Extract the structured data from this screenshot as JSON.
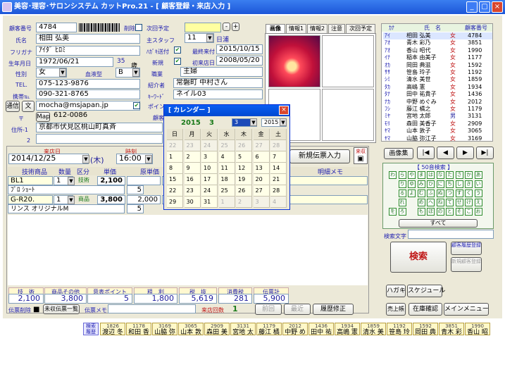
{
  "window": {
    "title": "美容･理容･サロンシステム カットPro.21 - [ 顧客登録・来店入力 ]",
    "min": "_",
    "max": "▢",
    "close": "×"
  },
  "customer": {
    "no_label": "顧客番号",
    "no": "4784",
    "delete_label": "削除",
    "name_label": "氏名",
    "name": "相田 弘美",
    "kana_label": "フリガナ",
    "kana": "ｱｲﾀﾞ ﾋﾛﾐ",
    "birth_label": "生年月日",
    "birth": "1972/06/21",
    "age": "35",
    "age_unit": "歳",
    "sex_label": "性別",
    "sex": "女",
    "blood_label": "血液型",
    "blood": "B",
    "tel_label": "TEL.",
    "tel": "075-123-9876",
    "mobile_label": "携帯℡",
    "mobile": "090-321-8765",
    "comm_btn": "通信",
    "text_btn": "文",
    "email": "mocha@msjapan.jp",
    "zip_label": "〒",
    "map_btn": "Map",
    "zip": "612-0086",
    "addr1_label": "住所-1",
    "addr1": "京都市伏見区桃山町真斉",
    "addr2_label": "2",
    "addr2": "",
    "next_label": "次回予定",
    "next_plus": "+",
    "next_minus": "-",
    "staff_label": "主スタッフ",
    "staff": "11",
    "staff_kind": "日浦",
    "dm_label": "ﾊｶﾞｷ送付",
    "last_label": "最終来付",
    "last_date": "2015/10/15",
    "new_label": "新規",
    "first_label": "初来店日",
    "first_date": "2008/05/20",
    "job_label": "職業",
    "job": "主婦",
    "intro_label": "紹介者",
    "intro": "常磐町 中村さん",
    "keyword_label": "ｷｰﾜｰﾄﾞ",
    "keyword": "ネイル03",
    "point_label": "ポイン",
    "note_label": "顧客"
  },
  "tabs": [
    "画像",
    "情報1",
    "情報2",
    "注意",
    "次回予定"
  ],
  "custlist": {
    "h1": "ｶﾅ",
    "h2": "氏　名",
    "h3": "顧客番号",
    "rows": [
      [
        "ｱｲ",
        "相田 弘美",
        "女",
        "4784"
      ],
      [
        "ｱｵ",
        "青木 彩乃",
        "女",
        "3851"
      ],
      [
        "ｱｵ",
        "香山 昭代",
        "女",
        "1990"
      ],
      [
        "ｲﾅ",
        "稲本 由美子",
        "女",
        "1177"
      ],
      [
        "ｵｶ",
        "岡田 典滋",
        "女",
        "1592"
      ],
      [
        "ｻｻ",
        "笹島 玲子",
        "女",
        "1192"
      ],
      [
        "ｼﾐ",
        "清水 美世",
        "女",
        "1859"
      ],
      [
        "ﾀｶ",
        "高嶋 憲",
        "女",
        "1934"
      ],
      [
        "ﾀﾅ",
        "田中 祐貴子",
        "女",
        "1436"
      ],
      [
        "ﾅｶ",
        "中野 めぐみ",
        "女",
        "2012"
      ],
      [
        "ﾌｼ",
        "藤江 橘之",
        "女",
        "1179"
      ],
      [
        "ﾐﾔ",
        "宮地 太郎",
        "男",
        "3131"
      ],
      [
        "ﾓﾘ",
        "森田 美香子",
        "女",
        "2909"
      ],
      [
        "ﾔﾏ",
        "山本 敦子",
        "女",
        "3065"
      ],
      [
        "ﾔﾏ",
        "山脇 弥江子",
        "女",
        "3169"
      ]
    ]
  },
  "image_label": "画像集",
  "nav": [
    "|◀",
    "◀",
    "▶",
    "▶|"
  ],
  "kana_title": "【 50音検索 】",
  "kana_rows": [
    [
      "わ",
      "ら",
      "や",
      "ま",
      "は",
      "な",
      "た",
      "さ",
      "か",
      "あ"
    ],
    [
      "",
      "り",
      "ゆ",
      "み",
      "ひ",
      "に",
      "ち",
      "し",
      "き",
      "い"
    ],
    [
      "",
      "る",
      "よ",
      "む",
      "ふ",
      "ぬ",
      "つ",
      "す",
      "く",
      "う"
    ],
    [
      "",
      "れ",
      "",
      "め",
      "へ",
      "ね",
      "て",
      "せ",
      "け",
      "え"
    ],
    [
      "を",
      "ろ",
      "",
      "も",
      "ほ",
      "の",
      "と",
      "そ",
      "こ",
      "お"
    ]
  ],
  "kana_all": "すべて",
  "search_text_label": "検索文字",
  "search_btn": "検索",
  "hist_btn": "顧客履歴登録",
  "newcust_btn": "新規顧客登録",
  "visit": {
    "date_label": "来店日",
    "date": "2014/12/25",
    "dow": "(木)",
    "time_label": "時刻",
    "time": "16:00",
    "newslip": "新規伝票入力",
    "tax_label": "来収"
  },
  "slip": {
    "headers": [
      "技術商品",
      "数量",
      "区分",
      "単価",
      "原単価",
      "明細メモ"
    ],
    "rows": [
      {
        "code": "BL1",
        "name": "ﾌﾟﾛ ｼｮｰﾄ",
        "qty": "1",
        "kind": "技術",
        "price": "2,100",
        "cost": "",
        "n": "5"
      },
      {
        "code": "G-R20.",
        "name": "リンス オリジナルM",
        "qty": "1",
        "kind": "商品",
        "price": "3,800",
        "cost": "2,000",
        "n": "5"
      }
    ]
  },
  "totals": {
    "labels": [
      "技　術",
      "商品その他",
      "意表ポイント",
      "粗　利",
      "税　抜",
      "消費税",
      "伝票計"
    ],
    "values": [
      "2,100",
      "3,800",
      "5",
      "1,800",
      "5,619",
      "281",
      "5,900"
    ]
  },
  "bottom": {
    "slipdel": "伝票削除",
    "slipdel_check": "■",
    "unreceived": "未収伝票一覧",
    "memo_label": "伝票メモ",
    "count_label": "来店回数",
    "count": "1",
    "prev": "前回",
    "recent": "最近",
    "fix": "履歴修正"
  },
  "right_btns": {
    "hagaki": "ハガキ",
    "schedule": "スケジュール",
    "sales": "売上帳",
    "stock": "在庫確認",
    "menu": "メインメニュー"
  },
  "hist": {
    "label": "検索履歴",
    "items": [
      [
        "1826",
        "渡辺 冬"
      ],
      [
        "1178",
        "和田 香"
      ],
      [
        "3169",
        "山脇 弥"
      ],
      [
        "3065",
        "山本 敦"
      ],
      [
        "2909",
        "森田 美"
      ],
      [
        "3131",
        "宮地 太"
      ],
      [
        "1179",
        "藤江 橘"
      ],
      [
        "2012",
        "中野 め"
      ],
      [
        "1436",
        "田中 祐"
      ],
      [
        "1934",
        "高嶋 憲"
      ],
      [
        "1859",
        "清水 美"
      ],
      [
        "1192",
        "笹島 玲"
      ],
      [
        "1592",
        "岡田 典"
      ],
      [
        "3851",
        "青木 彩"
      ],
      [
        "1990",
        "香山 昭"
      ]
    ]
  },
  "calendar": {
    "title": "[ カレンダー ]",
    "year": "2015",
    "month": "3",
    "month_sel": "3",
    "year_sel": "2015",
    "dow": [
      "日",
      "月",
      "火",
      "水",
      "木",
      "金",
      "土"
    ],
    "weeks": [
      [
        "22",
        "23",
        "24",
        "25",
        "26",
        "27",
        "28"
      ],
      [
        "1",
        "2",
        "3",
        "4",
        "5",
        "6",
        "7"
      ],
      [
        "8",
        "9",
        "10",
        "11",
        "12",
        "13",
        "14"
      ],
      [
        "15",
        "16",
        "17",
        "18",
        "19",
        "20",
        "21"
      ],
      [
        "22",
        "23",
        "24",
        "25",
        "26",
        "27",
        "28"
      ],
      [
        "29",
        "30",
        "31",
        "1",
        "2",
        "3",
        "4"
      ]
    ]
  }
}
